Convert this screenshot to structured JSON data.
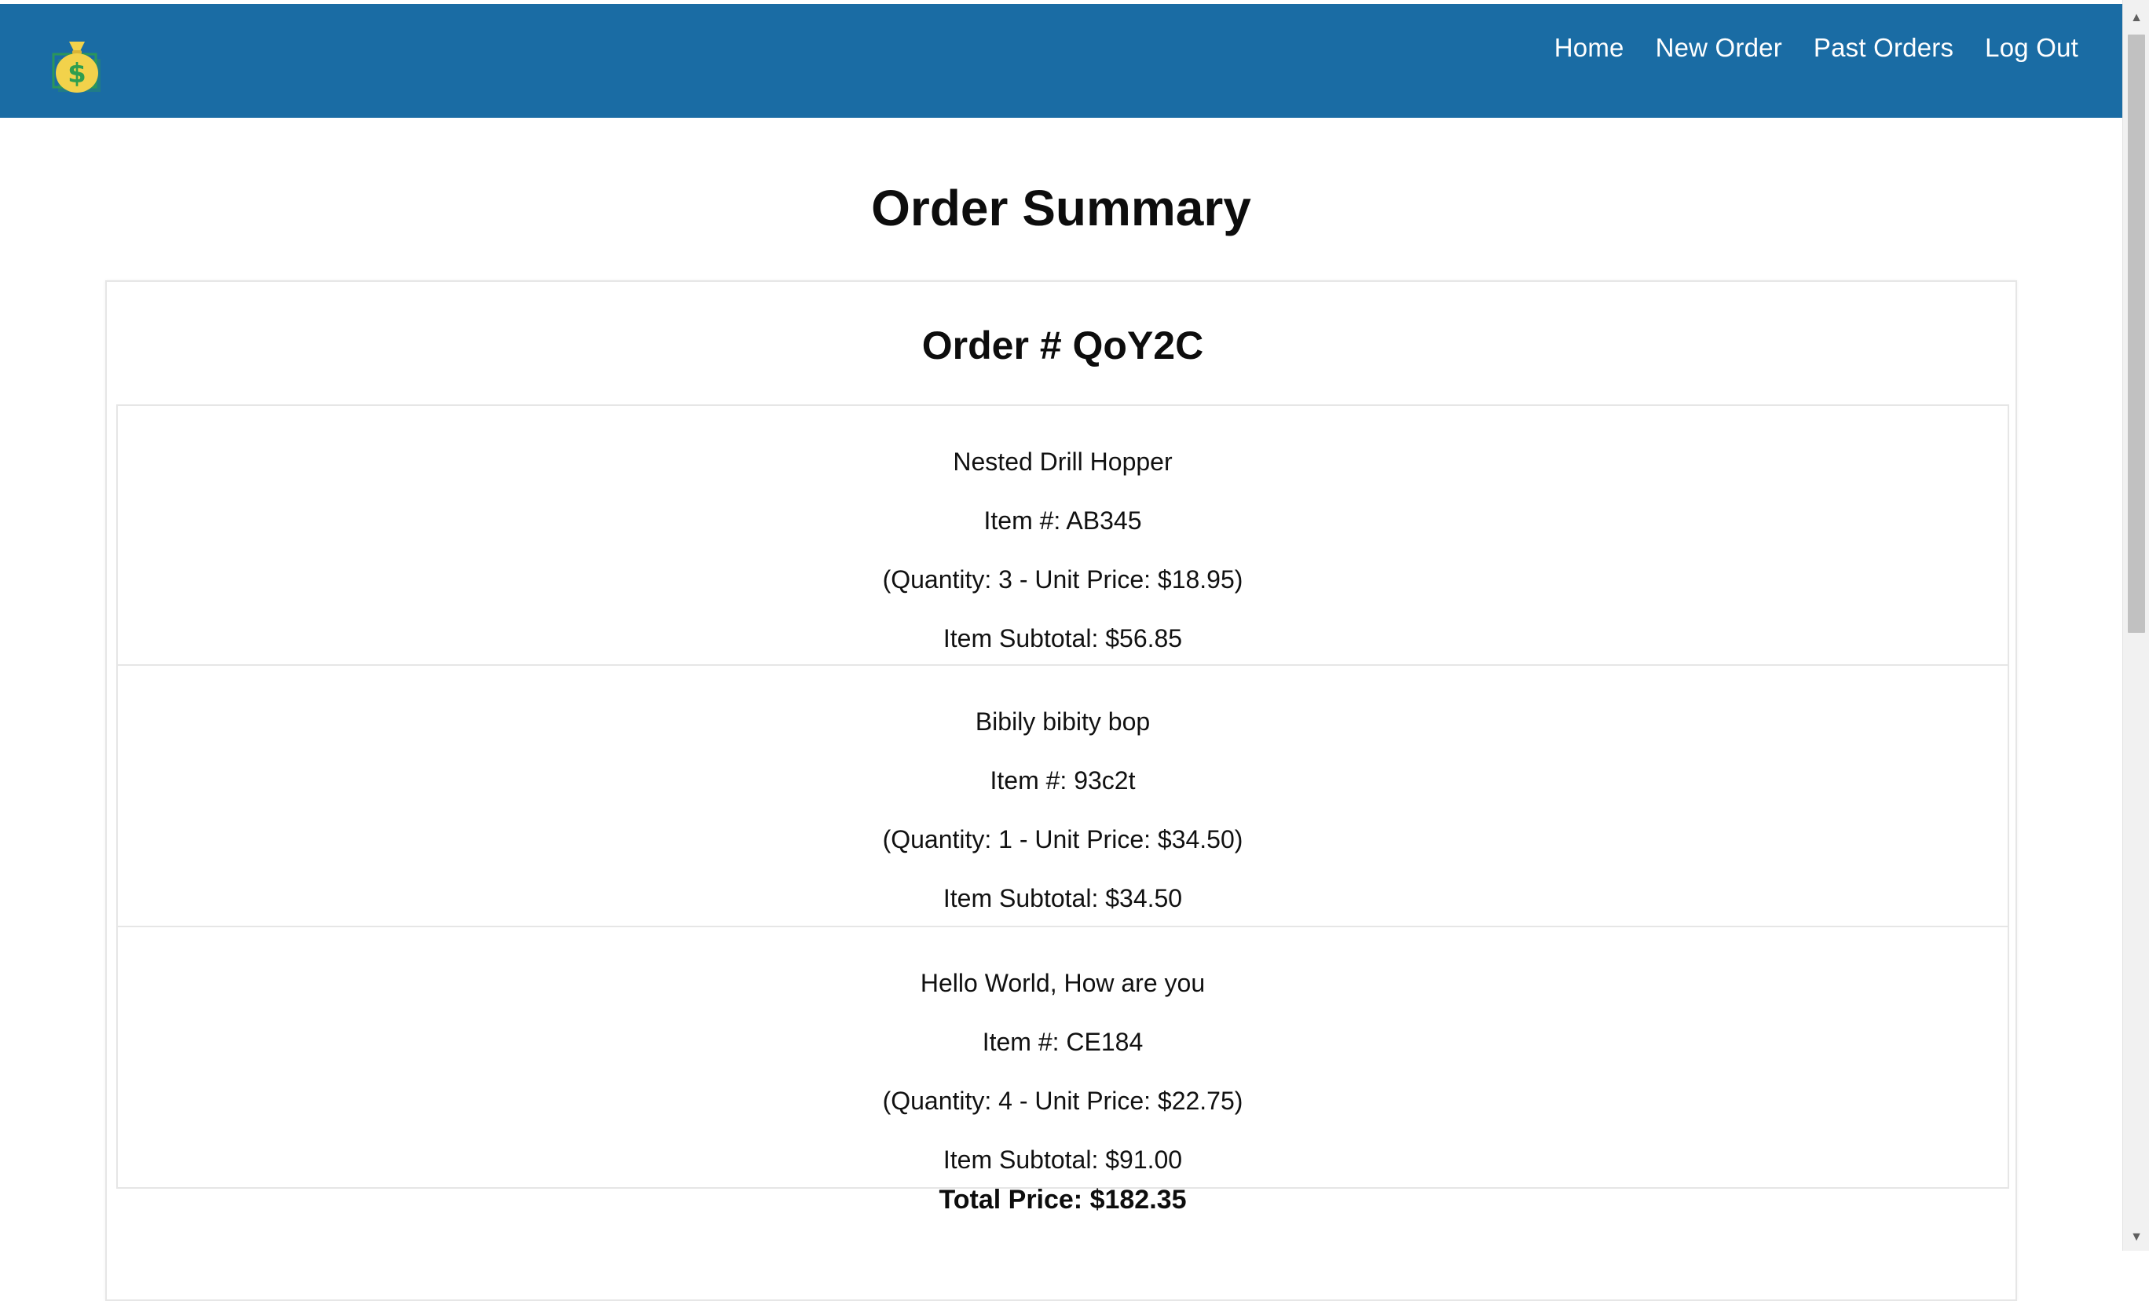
{
  "navbar": {
    "logo_icon": "money-bag-icon",
    "links": [
      {
        "label": "Home"
      },
      {
        "label": "New Order"
      },
      {
        "label": "Past Orders"
      },
      {
        "label": "Log Out"
      }
    ]
  },
  "page": {
    "title": "Order Summary"
  },
  "order": {
    "number_label": "Order # QoY2C",
    "items": [
      {
        "name": "Nested Drill Hopper",
        "item_number": "Item #: AB345",
        "quantity_price": "(Quantity: 3 - Unit Price: $18.95)",
        "subtotal": "Item Subtotal: $56.85"
      },
      {
        "name": "Bibily bibity bop",
        "item_number": "Item #: 93c2t",
        "quantity_price": "(Quantity: 1 - Unit Price: $34.50)",
        "subtotal": "Item Subtotal: $34.50"
      },
      {
        "name": "Hello World, How are you",
        "item_number": "Item #: CE184",
        "quantity_price": "(Quantity: 4 - Unit Price: $22.75)",
        "subtotal": "Item Subtotal: $91.00"
      }
    ],
    "total": "Total Price: $182.35"
  },
  "colors": {
    "navbar": "#1a6ca4",
    "logo_bag": "#f2d24b",
    "logo_dollar": "#2e9e4f"
  }
}
